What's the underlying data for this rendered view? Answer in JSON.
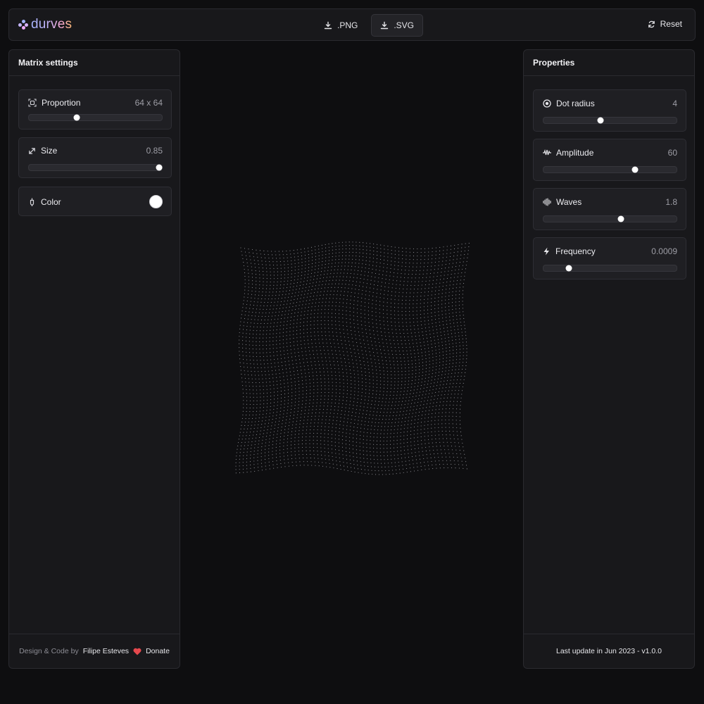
{
  "app": {
    "name": "durves"
  },
  "toolbar": {
    "png_label": ".PNG",
    "svg_label": ".SVG",
    "reset_label": "Reset"
  },
  "left_panel": {
    "title": "Matrix settings",
    "proportion": {
      "label": "Proportion",
      "value": "64 x 64",
      "level": 0.36
    },
    "size": {
      "label": "Size",
      "value": "0.85",
      "level": 0.98
    },
    "color": {
      "label": "Color",
      "swatch": "#ffffff"
    },
    "footer": {
      "prefix": "Design & Code by",
      "author": "Filipe Esteves",
      "donate": "Donate"
    }
  },
  "right_panel": {
    "title": "Properties",
    "dot_radius": {
      "label": "Dot radius",
      "value": "4",
      "level": 0.43
    },
    "amplitude": {
      "label": "Amplitude",
      "value": "60",
      "level": 0.69
    },
    "waves": {
      "label": "Waves",
      "value": "1.8",
      "level": 0.58
    },
    "frequency": {
      "label": "Frequency",
      "value": "0.0009",
      "level": 0.19
    },
    "footer": "Last update in Jun 2023 - v1.0.0"
  },
  "colors": {
    "background": "#0e0e10",
    "panel": "#18181b",
    "card": "#1f1f23",
    "accent_heart": "#e5484d",
    "dots": "#bdbdc4"
  }
}
